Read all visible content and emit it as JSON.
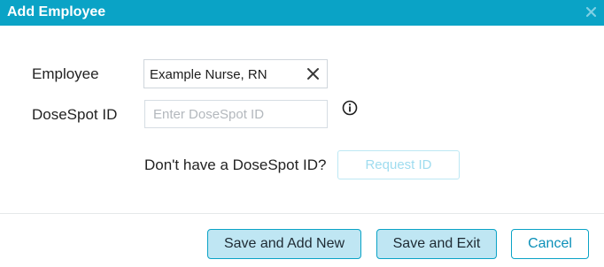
{
  "dialog": {
    "title": "Add Employee",
    "accent_color": "#0aa3c6"
  },
  "form": {
    "employee_label": "Employee",
    "employee_value": "Example Nurse, RN",
    "dosespot_label": "DoseSpot ID",
    "dosespot_placeholder": "Enter DoseSpot ID",
    "dosespot_value": "",
    "no_id_prompt": "Don't have a DoseSpot ID?",
    "request_id_label": "Request ID"
  },
  "footer": {
    "save_add_new_label": "Save and Add New",
    "save_exit_label": "Save and Exit",
    "cancel_label": "Cancel"
  },
  "icons": {
    "title_close": "close-icon",
    "employee_clear": "clear-icon",
    "info": "info-icon"
  }
}
